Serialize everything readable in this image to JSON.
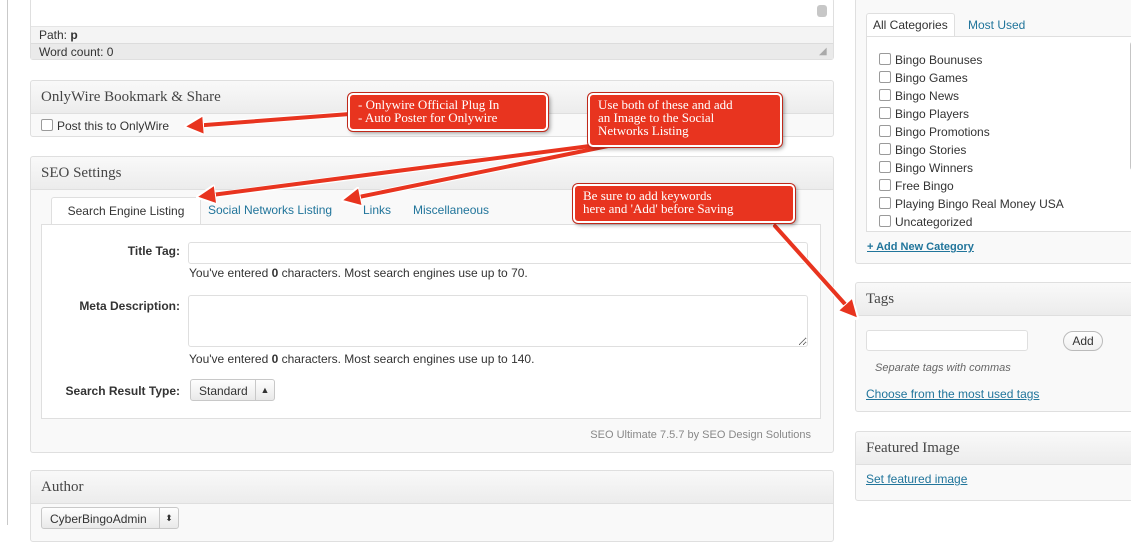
{
  "editor": {
    "path_label": "Path:",
    "path_value": "p",
    "word_count": "Word count: 0"
  },
  "onlywire": {
    "title": "OnlyWire Bookmark & Share",
    "checkbox_label": "Post this to OnlyWire"
  },
  "seo": {
    "title": "SEO Settings",
    "tabs": [
      "Search Engine Listing",
      "Social Networks Listing",
      "Links",
      "Miscellaneous"
    ],
    "title_tag_label": "Title Tag:",
    "title_tag_hint_pre": "You've entered ",
    "title_tag_count": "0",
    "title_tag_hint_post": " characters. Most search engines use up to 70.",
    "meta_label": "Meta Description:",
    "meta_hint_pre": "You've entered ",
    "meta_count": "0",
    "meta_hint_post": " characters. Most search engines use up to 140.",
    "result_type_label": "Search Result Type:",
    "result_type_value": "Standard",
    "footer": "SEO Ultimate 7.5.7 by SEO Design Solutions"
  },
  "author": {
    "title": "Author",
    "value": "CyberBingoAdmin"
  },
  "categories": {
    "tabs": [
      "All Categories",
      "Most Used"
    ],
    "items": [
      "Bingo Bounuses",
      "Bingo Games",
      "Bingo News",
      "Bingo Players",
      "Bingo Promotions",
      "Bingo Stories",
      "Bingo Winners",
      "Free Bingo",
      "Playing Bingo Real Money USA",
      "Uncategorized"
    ],
    "add_new": "+ Add New Category"
  },
  "tags": {
    "title": "Tags",
    "add_button": "Add",
    "hint": "Separate tags with commas",
    "most_used_link": "Choose from the most used tags"
  },
  "featured": {
    "title": "Featured Image",
    "link": "Set featured image"
  },
  "annotations": {
    "callout1_line1": "- Onlywire Official Plug In",
    "callout1_line2": "- Auto Poster for Onlywire",
    "callout2_line1": "Use both of these and add",
    "callout2_line2": "an Image to the Social",
    "callout2_line3": "Networks Listing",
    "callout3_line1": "Be sure to add keywords",
    "callout3_line2": "here and 'Add' before Saving"
  },
  "colors": {
    "link": "#21759b",
    "callout": "#e8341f",
    "panel_bg": "#f9f9f9",
    "border": "#dfdfdf"
  }
}
